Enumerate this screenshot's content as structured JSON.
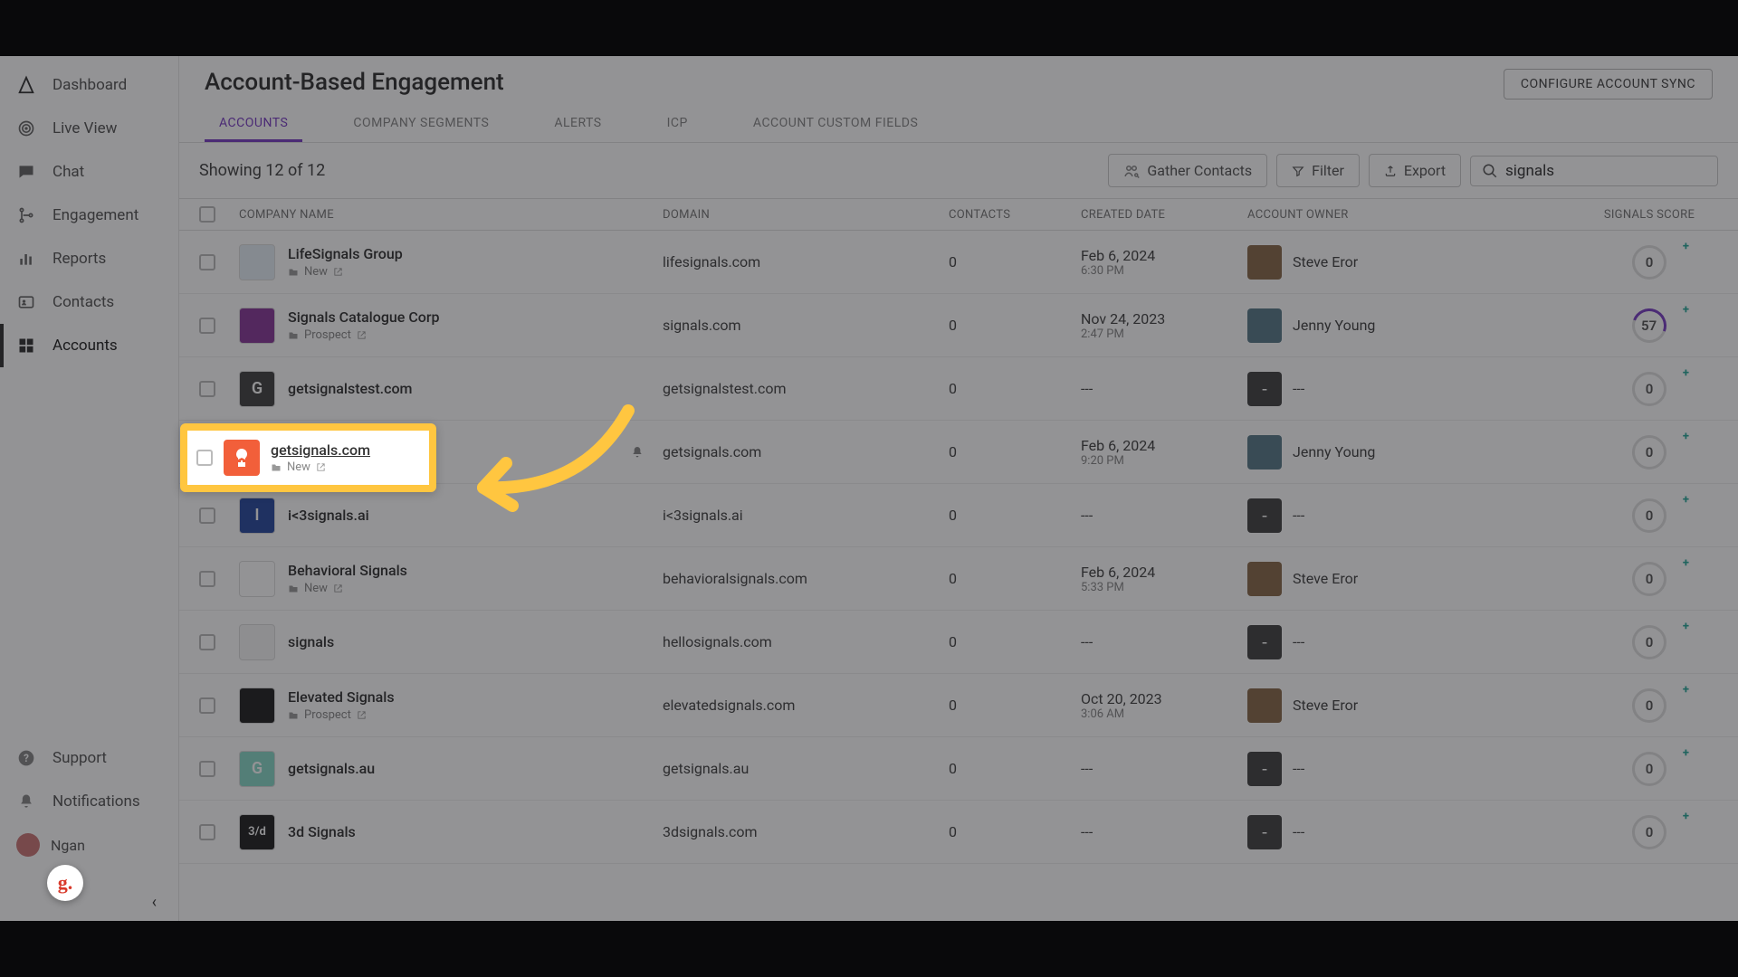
{
  "sidebar": {
    "items": [
      {
        "label": "Dashboard",
        "icon": "logo"
      },
      {
        "label": "Live View",
        "icon": "radar"
      },
      {
        "label": "Chat",
        "icon": "chat"
      },
      {
        "label": "Engagement",
        "icon": "branch"
      },
      {
        "label": "Reports",
        "icon": "bars"
      },
      {
        "label": "Contacts",
        "icon": "idcard"
      },
      {
        "label": "Accounts",
        "icon": "grid"
      }
    ],
    "bottom": [
      {
        "label": "Support",
        "icon": "help"
      },
      {
        "label": "Notifications",
        "icon": "bell"
      }
    ],
    "user": "Ngan"
  },
  "header": {
    "title": "Account-Based Engagement",
    "config_btn": "CONFIGURE ACCOUNT SYNC"
  },
  "tabs": [
    "ACCOUNTS",
    "COMPANY SEGMENTS",
    "ALERTS",
    "ICP",
    "ACCOUNT CUSTOM FIELDS"
  ],
  "toolbar": {
    "showing": "Showing 12 of  12",
    "gather": "Gather Contacts",
    "filter": "Filter",
    "export": "Export",
    "search_value": "signals"
  },
  "columns": [
    "COMPANY NAME",
    "DOMAIN",
    "CONTACTS",
    "CREATED DATE",
    "ACCOUNT OWNER",
    "SIGNALS SCORE"
  ],
  "highlight": {
    "name": "getsignals.com",
    "tag": "New"
  },
  "rows": [
    {
      "name": "LifeSignals Group",
      "tag": "New",
      "logo_bg": "#e6eef5",
      "logo_text": "",
      "domain": "lifesignals.com",
      "contacts": "0",
      "date": "Feb 6, 2024",
      "time": "6:30 PM",
      "owner": "Steve Eror",
      "owner_bg": "#8a6a4a",
      "score": "0"
    },
    {
      "name": "Signals Catalogue Corp",
      "tag": "Prospect",
      "logo_bg": "#8a3a9a",
      "logo_text": "",
      "domain": "signals.com",
      "contacts": "0",
      "date": "Nov 24, 2023",
      "time": "2:47 PM",
      "owner": "Jenny Young",
      "owner_bg": "#5a7a8a",
      "score": "57"
    },
    {
      "name": "getsignalstest.com",
      "tag": "",
      "logo_bg": "#444",
      "logo_text": "G",
      "domain": "getsignalstest.com",
      "contacts": "0",
      "date": "---",
      "time": "",
      "owner": "---",
      "owner_bg": "",
      "score": "0"
    },
    {
      "name": "getsignals.com",
      "tag": "New",
      "logo_bg": "#f25f3a",
      "logo_text": "",
      "domain": "getsignals.com",
      "contacts": "0",
      "date": "Feb 6, 2024",
      "time": "9:20 PM",
      "owner": "Jenny Young",
      "owner_bg": "#5a7a8a",
      "score": "0"
    },
    {
      "name": "i<3signals.ai",
      "tag": "",
      "logo_bg": "#2a4aa0",
      "logo_text": "I",
      "domain": "i<3signals.ai",
      "contacts": "0",
      "date": "---",
      "time": "",
      "owner": "---",
      "owner_bg": "",
      "score": "0"
    },
    {
      "name": "Behavioral Signals",
      "tag": "New",
      "logo_bg": "#fff",
      "logo_text": "",
      "domain": "behavioralsignals.com",
      "contacts": "0",
      "date": "Feb 6, 2024",
      "time": "5:33 PM",
      "owner": "Steve Eror",
      "owner_bg": "#8a6a4a",
      "score": "0"
    },
    {
      "name": "signals",
      "tag": "",
      "logo_bg": "#f5f5f5",
      "logo_text": "",
      "domain": "hellosignals.com",
      "contacts": "0",
      "date": "---",
      "time": "",
      "owner": "---",
      "owner_bg": "",
      "score": "0"
    },
    {
      "name": "Elevated Signals",
      "tag": "Prospect",
      "logo_bg": "#222",
      "logo_text": "",
      "domain": "elevatedsignals.com",
      "contacts": "0",
      "date": "Oct 20, 2023",
      "time": "3:06 AM",
      "owner": "Steve Eror",
      "owner_bg": "#8a6a4a",
      "score": "0"
    },
    {
      "name": "getsignals.au",
      "tag": "",
      "logo_bg": "#8ad8c8",
      "logo_text": "G",
      "domain": "getsignals.au",
      "contacts": "0",
      "date": "---",
      "time": "",
      "owner": "---",
      "owner_bg": "",
      "score": "0"
    },
    {
      "name": "3d Signals",
      "tag": "",
      "logo_bg": "#222",
      "logo_text": "3/d",
      "domain": "3dsignals.com",
      "contacts": "0",
      "date": "---",
      "time": "",
      "owner": "---",
      "owner_bg": "",
      "score": "0"
    }
  ]
}
